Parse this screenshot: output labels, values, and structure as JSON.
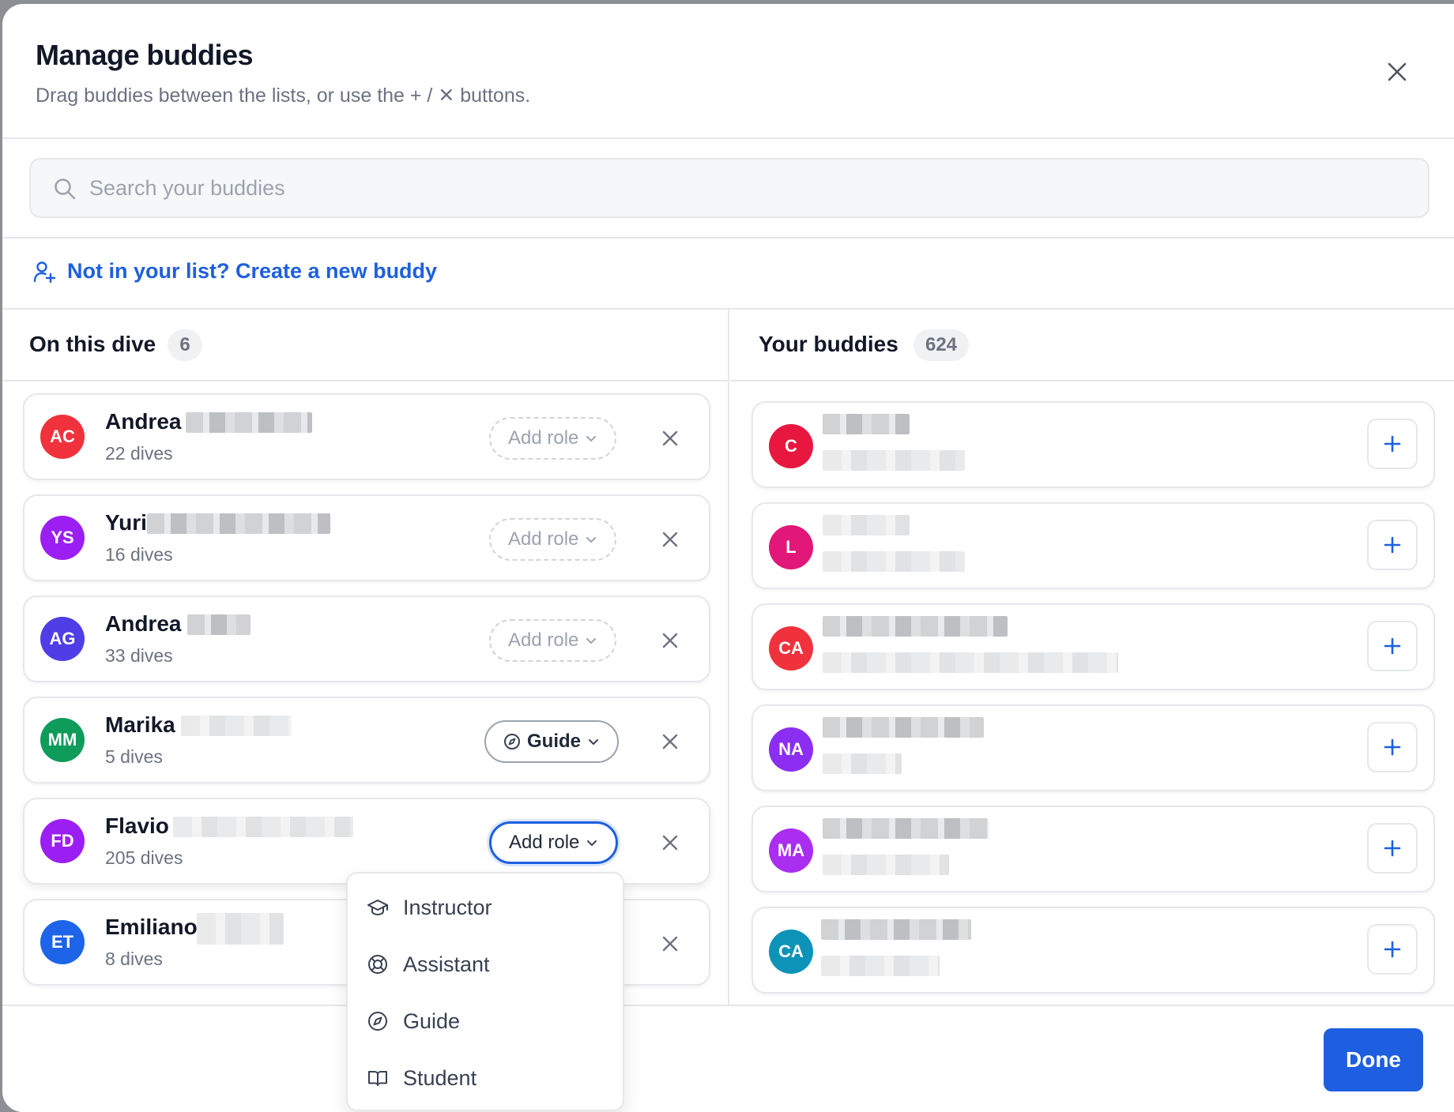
{
  "modal": {
    "title": "Manage buddies",
    "subtitle": "Drag buddies between the lists, or use the + / ✕ buttons."
  },
  "search": {
    "placeholder": "Search your buddies"
  },
  "create_link": "Not in your list? Create a new buddy",
  "on_dive": {
    "title": "On this dive",
    "count": "6",
    "buddies": [
      {
        "initials": "AC",
        "name": "Andrea",
        "dives": "22 dives",
        "color": "#f0323c",
        "role": "Add role",
        "role_set": false
      },
      {
        "initials": "YS",
        "name": "Yuri",
        "dives": "16 dives",
        "color": "#9b1ff2",
        "role": "Add role",
        "role_set": false
      },
      {
        "initials": "AG",
        "name": "Andrea",
        "dives": "33 dives",
        "color": "#4f3de6",
        "role": "Add role",
        "role_set": false
      },
      {
        "initials": "MM",
        "name": "Marika",
        "dives": "5 dives",
        "color": "#0f9b5a",
        "role": "Guide",
        "role_set": true
      },
      {
        "initials": "FD",
        "name": "Flavio",
        "dives": "205 dives",
        "color": "#9b1ff2",
        "role": "Add role",
        "role_set": false
      },
      {
        "initials": "ET",
        "name": "Emiliano",
        "dives": "8 dives",
        "color": "#1d64e8",
        "role": "",
        "role_set": false
      }
    ]
  },
  "your_buddies": {
    "title": "Your buddies",
    "count": "624",
    "buddies": [
      {
        "initials": "C",
        "color": "#e8173f"
      },
      {
        "initials": "L",
        "color": "#e2177a"
      },
      {
        "initials": "CA",
        "color": "#f0323c"
      },
      {
        "initials": "NA",
        "color": "#8b2ef2"
      },
      {
        "initials": "MA",
        "color": "#a92ef0"
      },
      {
        "initials": "CA",
        "color": "#0d93b8"
      }
    ]
  },
  "role_menu": {
    "items": [
      {
        "label": "Instructor",
        "icon": "graduation-cap-icon"
      },
      {
        "label": "Assistant",
        "icon": "life-buoy-icon"
      },
      {
        "label": "Guide",
        "icon": "compass-icon"
      },
      {
        "label": "Student",
        "icon": "book-open-icon"
      }
    ]
  },
  "footer": {
    "done_label": "Done"
  },
  "colors": {
    "accent": "#1d5fe0"
  }
}
